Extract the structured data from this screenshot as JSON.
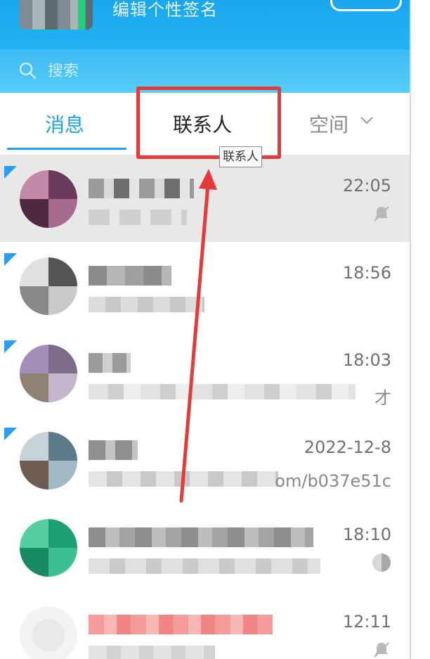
{
  "header": {
    "signature_label": "编辑个性签名"
  },
  "search": {
    "placeholder": "搜索"
  },
  "tabs": [
    {
      "label": "消息"
    },
    {
      "label": "联系人"
    },
    {
      "label": "空间"
    }
  ],
  "tooltip": {
    "text": "联系人"
  },
  "conversations": [
    {
      "time": "22:05",
      "preview_visible": ""
    },
    {
      "time": "18:56",
      "preview_visible": ""
    },
    {
      "time": "18:03",
      "preview_visible": "才"
    },
    {
      "time": "2022-12-8",
      "preview_visible": "om/b037e51c"
    },
    {
      "time": "18:10",
      "preview_visible": ""
    },
    {
      "time": "12:11",
      "preview_visible": ""
    }
  ],
  "colors": {
    "accent": "#1da1f2",
    "header_blue": "#23b3f2",
    "highlight_red": "#e53a3a",
    "selected_row": "#e8e8e8"
  }
}
